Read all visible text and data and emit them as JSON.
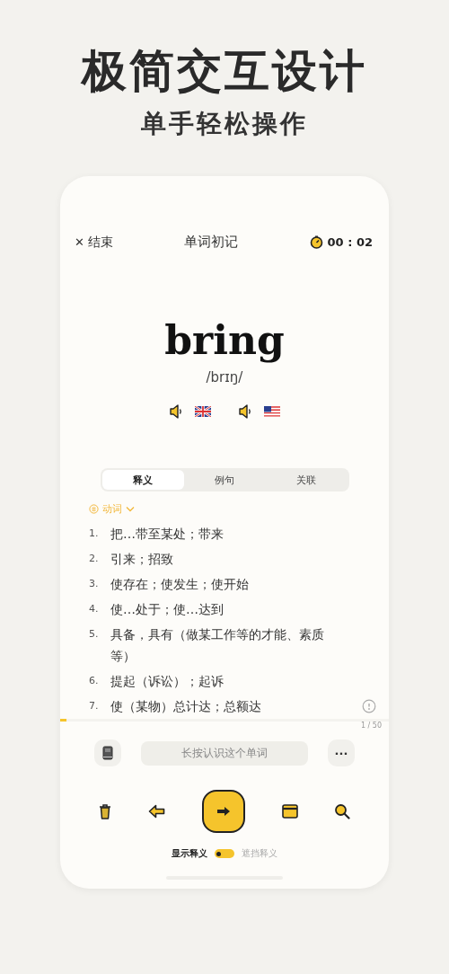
{
  "headline": "极简交互设计",
  "subheadline": "单手轻松操作",
  "header": {
    "close_label": "结束",
    "close_icon": "✕",
    "title": "单词初记",
    "timer": "00 : 02"
  },
  "word": {
    "text": "bring",
    "phonetic": "/brɪŋ/"
  },
  "pronunciations": [
    {
      "kind": "uk"
    },
    {
      "kind": "us"
    }
  ],
  "tabs": [
    {
      "label": "释义",
      "selected": true
    },
    {
      "label": "例句",
      "selected": false
    },
    {
      "label": "关联",
      "selected": false
    }
  ],
  "part_of_speech": "动词",
  "definitions": [
    {
      "number": "1.",
      "text": "把…带至某处；带来"
    },
    {
      "number": "2.",
      "text": "引来；招致"
    },
    {
      "number": "3.",
      "text": "使存在；使发生；使开始"
    },
    {
      "number": "4.",
      "text": "使…处于；使…达到"
    },
    {
      "number": "5.",
      "text": "具备，具有（做某工作等的才能、素质等）"
    },
    {
      "number": "6.",
      "text": "提起（诉讼）；起诉"
    },
    {
      "number": "7.",
      "text": "使（某物）总计达；总额达"
    }
  ],
  "progress": {
    "level": 0.02,
    "counter": "1 / 50"
  },
  "hint_button": "长按认识这个单词",
  "more_button": "···",
  "toolbar": [
    {
      "kind": "trash"
    },
    {
      "kind": "back"
    },
    {
      "kind": "next"
    },
    {
      "kind": "card"
    },
    {
      "kind": "search"
    }
  ],
  "display_switch": {
    "on": false
  },
  "display_toggle": [
    {
      "label": "显示释义",
      "selected": true
    },
    {
      "label": "遮挡释义",
      "selected": false
    }
  ]
}
